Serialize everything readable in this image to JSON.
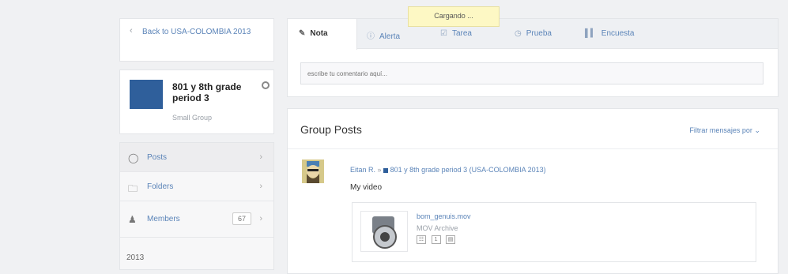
{
  "loading": {
    "text": "Cargando ..."
  },
  "sidebar": {
    "back_label": "Back to USA-COLOMBIA 2013",
    "group": {
      "name": "801 y 8th grade period 3",
      "type": "Small Group"
    },
    "nav": [
      {
        "label": "Posts"
      },
      {
        "label": "Folders"
      },
      {
        "label": "Members",
        "count": "67"
      }
    ],
    "footer_text": "2013"
  },
  "composer": {
    "tabs": [
      {
        "label": "Nota",
        "icon": "note-icon"
      },
      {
        "label": "Alerta",
        "icon": "alert-icon"
      },
      {
        "label": "Tarea",
        "icon": "assignment-icon"
      },
      {
        "label": "Prueba",
        "icon": "quiz-icon"
      },
      {
        "label": "Encuesta",
        "icon": "poll-icon"
      }
    ],
    "comment_placeholder": "escribe tu comentario aquí..."
  },
  "posts": {
    "title": "Group Posts",
    "filter_label": "Filtrar mensajes por",
    "items": [
      {
        "author": "Eitan R.",
        "group_ref": "801 y 8th grade period 3 (USA-COLOMBIA 2013)",
        "message": "My video",
        "attachment": {
          "file_name": "bom_genuis.mov",
          "file_type": "MOV Archive",
          "count": "1"
        }
      }
    ]
  },
  "colors": {
    "accent": "#5b84b8",
    "group_swatch": "#2f5f9b",
    "loading_bg": "#fdf8c4"
  }
}
